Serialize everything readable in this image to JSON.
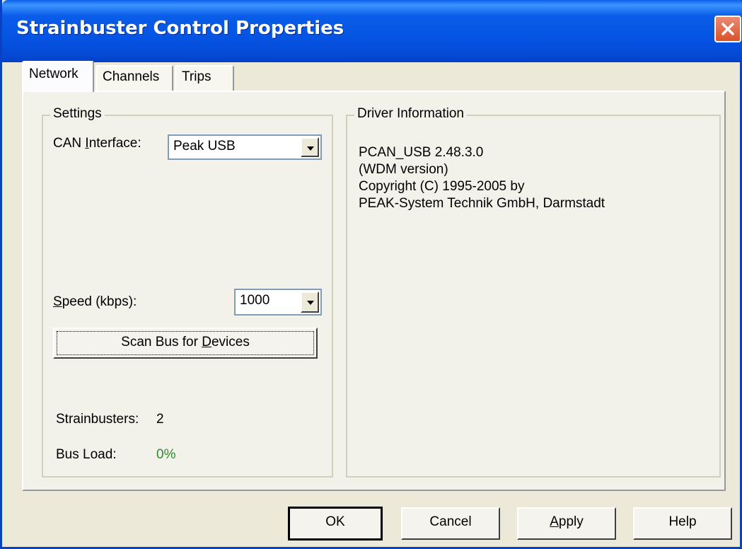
{
  "window": {
    "title": "Strainbuster Control Properties"
  },
  "tabs": [
    {
      "label": "Network"
    },
    {
      "label": "Channels"
    },
    {
      "label": "Trips"
    }
  ],
  "settings": {
    "legend": "Settings",
    "can_interface_label_pre": "CAN ",
    "can_interface_label_u": "I",
    "can_interface_label_post": "nterface:",
    "can_interface_value": "Peak USB",
    "speed_label_u": "S",
    "speed_label_post": "peed (kbps):",
    "speed_value": "1000",
    "scan_button_pre": "Scan Bus for ",
    "scan_button_u": "D",
    "scan_button_post": "evices",
    "strainbusters_label": "Strainbusters:",
    "strainbusters_value": "2",
    "bus_load_label": "Bus Load:",
    "bus_load_value": "0%",
    "bus_load_color": "#2E8B2E"
  },
  "driver": {
    "legend": "Driver Information",
    "lines": [
      "PCAN_USB 2.48.3.0",
      "(WDM version)",
      "Copyright (C) 1995-2005 by",
      "PEAK-System Technik GmbH, Darmstadt"
    ]
  },
  "buttons": {
    "ok": "OK",
    "cancel": "Cancel",
    "apply_u": "A",
    "apply_post": "pply",
    "help": "Help"
  }
}
